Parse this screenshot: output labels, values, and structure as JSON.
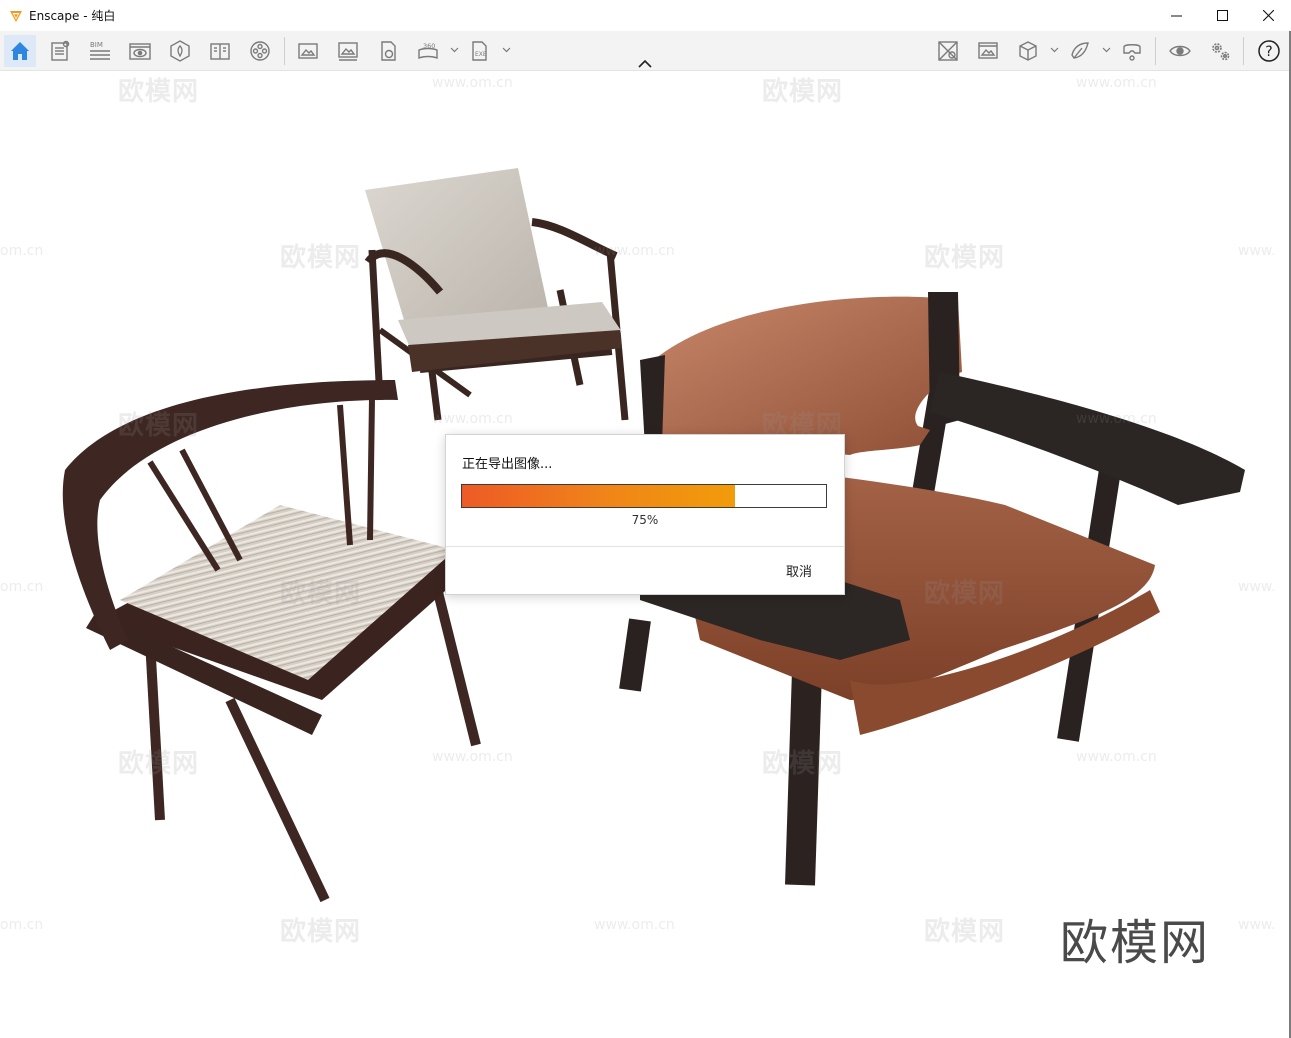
{
  "window": {
    "title": "Enscape - 纯白",
    "controls": [
      "minimize-icon",
      "maximize-icon",
      "close-icon"
    ]
  },
  "toolbar": {
    "left_tools": [
      {
        "name": "home-icon",
        "active": true
      },
      {
        "name": "document-settings-icon"
      },
      {
        "name": "bim-icon",
        "label": "BIM"
      },
      {
        "name": "view-eye-icon"
      },
      {
        "name": "asset-library-icon"
      },
      {
        "name": "material-book-icon"
      },
      {
        "name": "video-reel-icon"
      },
      {
        "name": "screenshot-icon"
      },
      {
        "name": "batch-render-icon"
      },
      {
        "name": "export-web-icon"
      },
      {
        "name": "panorama-360-icon",
        "label": "360",
        "has_dropdown": true
      },
      {
        "name": "export-exe-icon",
        "label": "EXE",
        "has_dropdown": true
      }
    ],
    "right_tools": [
      {
        "name": "map-view-icon"
      },
      {
        "name": "visual-settings-icon"
      },
      {
        "name": "cube-view-icon",
        "has_dropdown": true
      },
      {
        "name": "sketch-icon",
        "has_dropdown": true
      },
      {
        "name": "vr-headset-icon"
      },
      {
        "name": "visibility-eye-icon"
      },
      {
        "name": "settings-gears-icon"
      },
      {
        "name": "help-icon",
        "label": "?"
      }
    ],
    "collapse": "chevron-up-icon"
  },
  "viewport": {
    "background": "#ffffff",
    "watermarks": {
      "cn": "欧模网",
      "url": "www.om.cn",
      "partial_cn": "om.cn",
      "partial_url": "www."
    },
    "brand_watermark": "欧模网"
  },
  "export_dialog": {
    "title": "正在导出图像...",
    "progress": 0.75,
    "progress_text": "75%",
    "cancel_label": "取消",
    "colors": {
      "fill_start": "#ee5a26",
      "fill_end": "#f19c0a"
    }
  }
}
